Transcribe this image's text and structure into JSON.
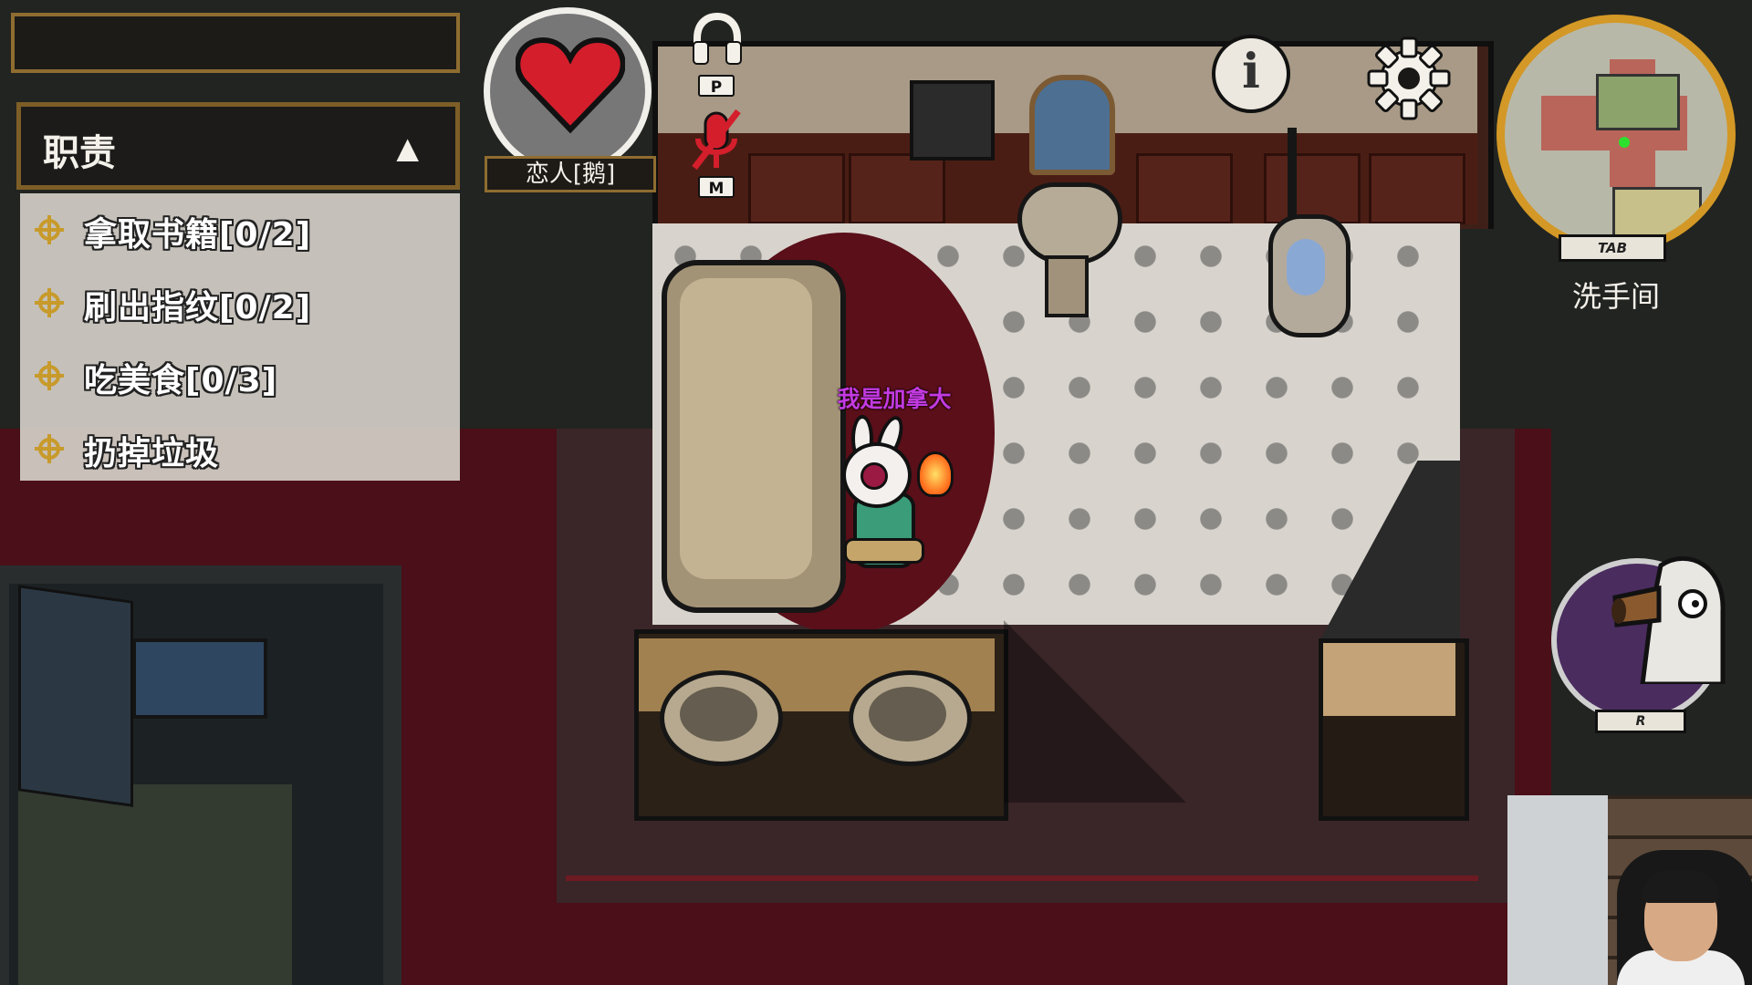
{
  "tasks": {
    "header": "职责",
    "collapse_icon": "collapse-up-icon",
    "items": [
      {
        "label": "拿取书籍[0/2]",
        "icon": "quest-target-icon"
      },
      {
        "label": "刷出指纹[0/2]",
        "icon": "quest-target-icon"
      },
      {
        "label": "吃美食[0/3]",
        "icon": "quest-target-icon"
      },
      {
        "label": "扔掉垃圾",
        "icon": "quest-target-icon"
      }
    ]
  },
  "role": {
    "label": "恋人[鹅]",
    "icon": "heart-icon",
    "color": "#d41e2c"
  },
  "voice": {
    "headphones_key": "P",
    "mic_key": "M",
    "mic_muted": true
  },
  "player": {
    "name": "我是加拿大",
    "name_color": "#c33ae0"
  },
  "minimap": {
    "key": "TAB",
    "location": "洗手间"
  },
  "ability": {
    "key": "R"
  },
  "colors": {
    "accent_gold": "#8f6d30",
    "minimap_ring": "#d39826"
  }
}
